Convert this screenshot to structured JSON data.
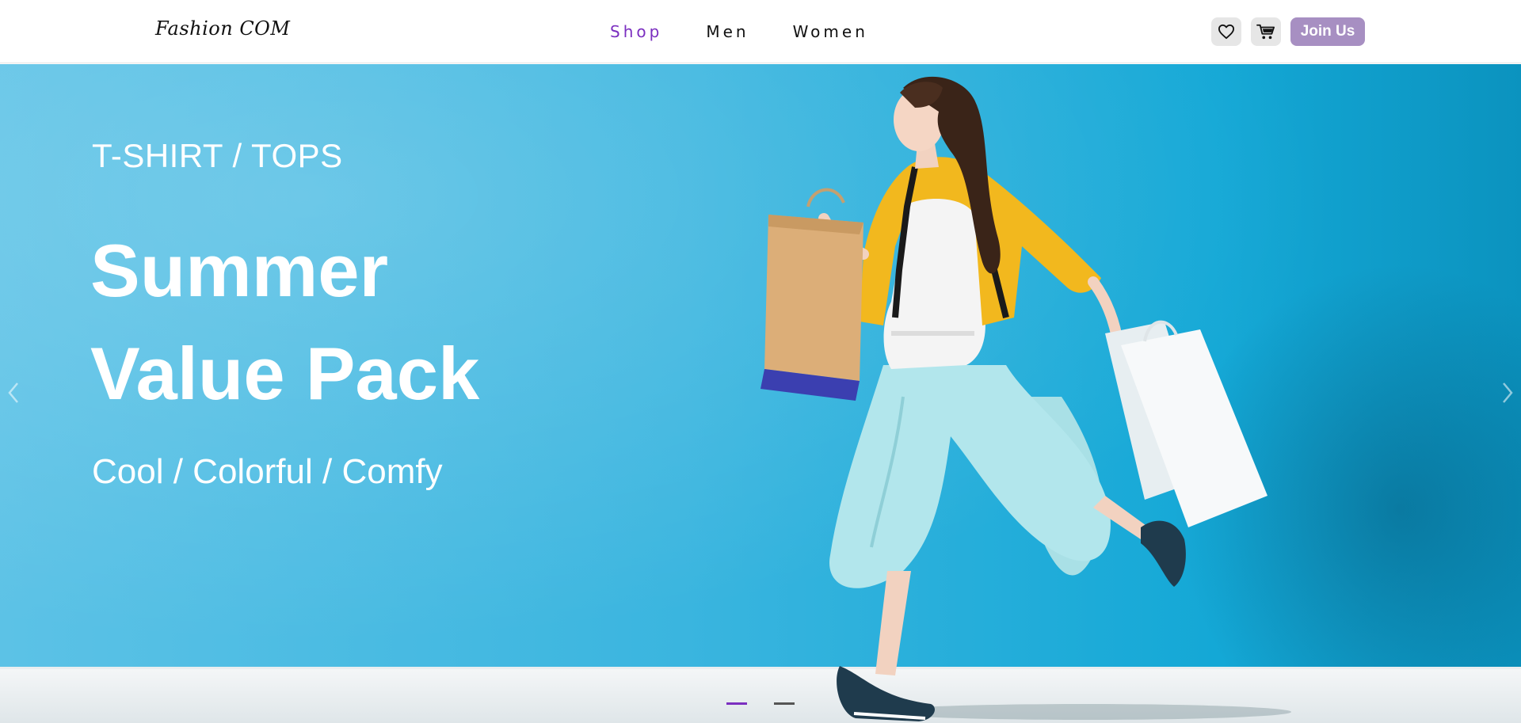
{
  "header": {
    "logo": "Fashion COM",
    "nav": [
      {
        "label": "Shop",
        "active": true
      },
      {
        "label": "Men",
        "active": false
      },
      {
        "label": "Women",
        "active": false
      }
    ],
    "wishlist_icon": "heart-icon",
    "cart_icon": "cart-icon",
    "join_label": "Join Us"
  },
  "hero": {
    "category": "T-SHIRT / TOPS",
    "title_line1": "Summer",
    "title_line2": "Value Pack",
    "subtitle": "Cool / Colorful / Comfy",
    "prev_icon": "chevron-left-icon",
    "next_icon": "chevron-right-icon",
    "slides": [
      {
        "active": true
      },
      {
        "active": false
      }
    ]
  },
  "colors": {
    "accent": "#7b2fc0",
    "join_button": "#a78fc2",
    "hero_background": "#29b1de"
  }
}
